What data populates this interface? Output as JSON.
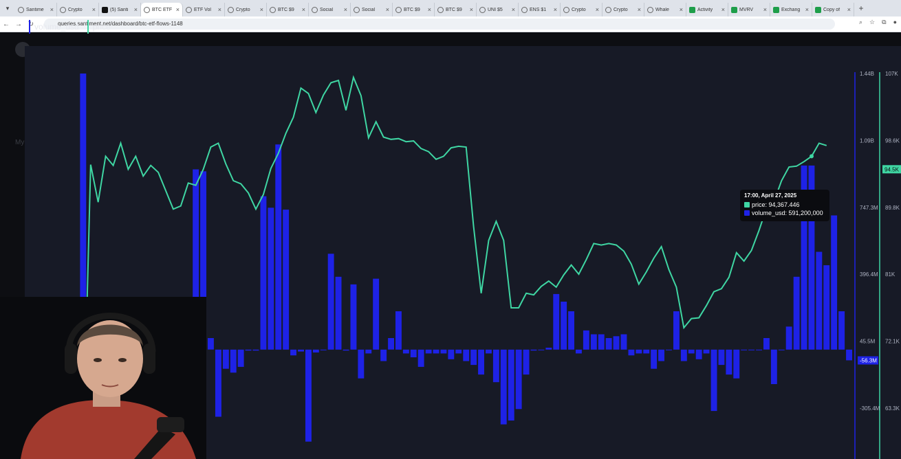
{
  "browser": {
    "tabs": [
      {
        "label": "Santime",
        "icon": "santiment-icon"
      },
      {
        "label": "Crypto",
        "icon": "globe-icon"
      },
      {
        "label": "(5) Santi",
        "icon": "x-icon"
      },
      {
        "label": "BTC ETF",
        "icon": "globe-icon",
        "active": true
      },
      {
        "label": "ETF Vol",
        "icon": "globe-icon"
      },
      {
        "label": "Crypto",
        "icon": "globe-icon"
      },
      {
        "label": "BTC $9",
        "icon": "globe-icon"
      },
      {
        "label": "Social",
        "icon": "globe-icon"
      },
      {
        "label": "Social",
        "icon": "globe-icon"
      },
      {
        "label": "BTC $9",
        "icon": "globe-icon"
      },
      {
        "label": "BTC $9",
        "icon": "globe-icon"
      },
      {
        "label": "UNI $5",
        "icon": "globe-icon"
      },
      {
        "label": "ENS $1",
        "icon": "globe-icon"
      },
      {
        "label": "Crypto",
        "icon": "globe-icon"
      },
      {
        "label": "Crypto",
        "icon": "globe-icon"
      },
      {
        "label": "Whale",
        "icon": "globe-icon"
      },
      {
        "label": "Activity",
        "icon": "sheets-icon"
      },
      {
        "label": "MVRV",
        "icon": "sheets-icon"
      },
      {
        "label": "Exchang",
        "icon": "sheets-icon"
      },
      {
        "label": "Copy of",
        "icon": "sheets-icon"
      }
    ],
    "url": "queries.santiment.net/dashboard/btc-etf-flows-1148"
  },
  "sidebar": {
    "label": "My"
  },
  "chart_data": {
    "type": "bar+line",
    "legend": [
      "volume_usd",
      "price"
    ],
    "colors": {
      "volume": "#1e22e6",
      "price": "#3fd6a3",
      "background": "#171a26"
    },
    "volume_axis": {
      "ticks": [
        "1.44B",
        "1.09B",
        "747.3M",
        "396.4M",
        "45.5M",
        "-305.4M"
      ],
      "current_label": "-56.3M"
    },
    "price_axis": {
      "ticks": [
        "107K",
        "98.6K",
        "89.8K",
        "81K",
        "72.1K",
        "63.3K"
      ],
      "current_label": "94.5K"
    },
    "series": [
      {
        "name": "volume_usd",
        "unit": "USD millions",
        "values": [
          -15,
          10,
          80,
          -5,
          50,
          -20,
          170,
          1440,
          -5,
          -80,
          150,
          130,
          80,
          -30,
          140,
          -110,
          -90,
          -50,
          -150,
          -5,
          -60,
          -90,
          940,
          930,
          60,
          -350,
          -100,
          -120,
          -90,
          -5,
          -5,
          800,
          740,
          1070,
          730,
          -30,
          -10,
          -480,
          -15,
          0,
          500,
          380,
          -5,
          340,
          -150,
          -20,
          370,
          -60,
          60,
          200,
          -20,
          -40,
          -90,
          -20,
          -20,
          -20,
          -50,
          -20,
          -60,
          -80,
          -130,
          -20,
          -170,
          -390,
          -370,
          -310,
          -130,
          -5,
          0,
          10,
          290,
          250,
          200,
          -20,
          100,
          80,
          80,
          60,
          70,
          80,
          -30,
          -20,
          -20,
          -100,
          -60,
          0,
          200,
          -60,
          -20,
          -50,
          -20,
          -320,
          -80,
          -130,
          -150,
          0,
          0,
          0,
          60,
          -180,
          0,
          120,
          380,
          960,
          960,
          510,
          440,
          700,
          200,
          -56
        ]
      },
      {
        "name": "price",
        "unit": "USD thousands",
        "values": [
          null,
          null,
          null,
          null,
          null,
          null,
          null,
          57.3,
          95.1,
          90.2,
          96.2,
          95.0,
          97.9,
          94.5,
          96.2,
          93.6,
          95.0,
          94.1,
          91.7,
          89.3,
          89.7,
          92.7,
          92.4,
          94.5,
          97.4,
          97.9,
          95.2,
          93.0,
          92.6,
          91.4,
          89.3,
          91.2,
          94.6,
          96.6,
          99.2,
          101.3,
          105.1,
          104.4,
          101.9,
          104.2,
          105.8,
          106.1,
          102.2,
          106.5,
          104.1,
          98.6,
          100.7,
          98.7,
          98.4,
          98.5,
          98.1,
          98.2,
          97.2,
          96.8,
          95.8,
          96.2,
          97.3,
          97.5,
          97.4,
          87.0,
          78.3,
          85.2,
          87.7,
          85.2,
          76.4,
          76.4,
          78.3,
          78.1,
          79.2,
          79.9,
          79.1,
          80.7,
          82.0,
          80.8,
          82.7,
          84.8,
          84.6,
          84.8,
          84.6,
          83.8,
          82.1,
          79.5,
          81.1,
          82.9,
          84.4,
          81.4,
          79.1,
          73.8,
          75.0,
          75.1,
          76.7,
          78.5,
          78.9,
          80.4,
          83.6,
          82.5,
          83.9,
          86.5,
          89.4,
          90.3,
          93.0,
          94.8,
          94.9,
          95.5,
          96.2,
          97.9,
          97.6
        ]
      }
    ],
    "tooltip": {
      "time": "17:00, April 27, 2025",
      "price_label": "price: 94,367.446",
      "volume_label": "volume_usd: 591,200,000"
    }
  }
}
